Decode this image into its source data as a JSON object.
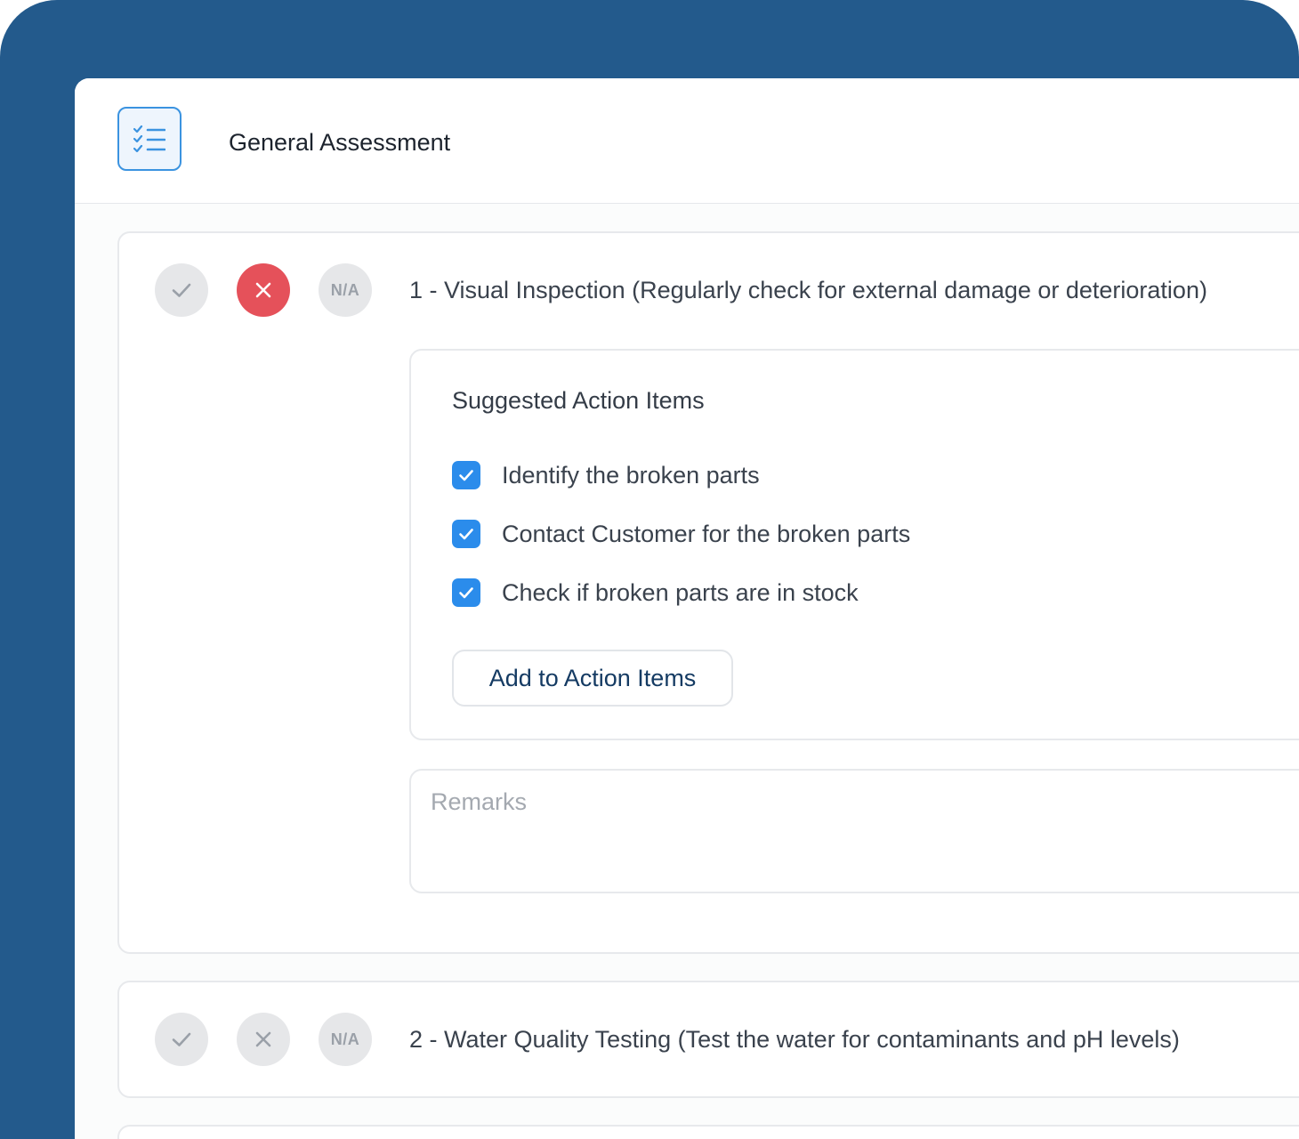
{
  "header": {
    "icon": "checklist-icon",
    "title": "General Assessment"
  },
  "colors": {
    "frame": "#235a8c",
    "accent": "#2b8ceb",
    "fail_active": "#e5515a",
    "button_text": "#153b63"
  },
  "items": [
    {
      "question": "1 - Visual Inspection (Regularly check for external damage or deterioration)",
      "status_buttons": {
        "pass_icon": "check-icon",
        "fail_icon": "close-icon",
        "na_label": "N/A"
      },
      "selected": "fail",
      "suggested": {
        "title": "Suggested Action Items",
        "items": [
          {
            "label": "Identify the broken parts",
            "checked": true
          },
          {
            "label": "Contact Customer for the broken parts",
            "checked": true
          },
          {
            "label": "Check if broken parts are in stock",
            "checked": true
          }
        ],
        "button_label": "Add to Action Items"
      },
      "remarks": {
        "placeholder": "Remarks",
        "value": ""
      }
    },
    {
      "question": "2 - Water Quality Testing (Test the water for contaminants and pH levels)",
      "status_buttons": {
        "pass_icon": "check-icon",
        "fail_icon": "close-icon",
        "na_label": "N/A"
      },
      "selected": "none"
    }
  ]
}
